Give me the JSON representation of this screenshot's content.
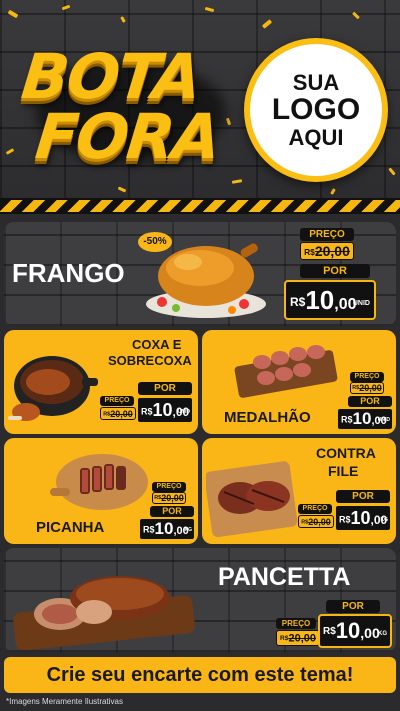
{
  "header": {
    "title_line1": "BOTA",
    "title_line2": "FORA",
    "logo_line1": "SUA",
    "logo_line2": "LOGO",
    "logo_line3": "AQUI"
  },
  "products": {
    "frango": {
      "name": "FRANGO",
      "discount": "-50%",
      "old_label": "PREÇO",
      "old_currency": "R$",
      "old_price": "20,00",
      "new_label": "POR",
      "new_currency": "R$",
      "new_price_int": "10",
      "new_price_dec": ",00",
      "unit": "UNID"
    },
    "coxa": {
      "name_line1": "COXA E",
      "name_line2": "SOBRECOXA",
      "old_label": "PREÇO",
      "old_currency": "R$",
      "old_price": "20,00",
      "new_label": "POR",
      "new_currency": "R$",
      "new_price_int": "10",
      "new_price_dec": ",00",
      "unit": "UNID"
    },
    "medalhao": {
      "name": "MEDALHÃO",
      "old_label": "PREÇO",
      "old_currency": "R$",
      "old_price": "20,00",
      "new_label": "POR",
      "new_currency": "R$",
      "new_price_int": "10",
      "new_price_dec": ",00",
      "unit": "UNID"
    },
    "picanha": {
      "name": "PICANHA",
      "old_label": "PREÇO",
      "old_currency": "R$",
      "old_price": "20,00",
      "new_label": "POR",
      "new_currency": "R$",
      "new_price_int": "10",
      "new_price_dec": ",00",
      "unit": "KG"
    },
    "contrafile": {
      "name_line1": "CONTRA",
      "name_line2": "FILE",
      "old_label": "PREÇO",
      "old_currency": "R$",
      "old_price": "20,00",
      "new_label": "POR",
      "new_currency": "R$",
      "new_price_int": "10",
      "new_price_dec": ",00",
      "unit": "KG"
    },
    "pancetta": {
      "name": "PANCETTA",
      "old_label": "PREÇO",
      "old_currency": "R$",
      "old_price": "20,00",
      "new_label": "POR",
      "new_currency": "R$",
      "new_price_int": "10",
      "new_price_dec": ",00",
      "unit": "KG"
    }
  },
  "cta": "Crie seu encarte com este tema!",
  "disclaimer": "*Imagens Meramente Ilustrativas",
  "colors": {
    "accent_yellow": "#f9b616",
    "dark_panel": "#3e3e40",
    "background": "#2b2b2d",
    "black": "#111111"
  }
}
